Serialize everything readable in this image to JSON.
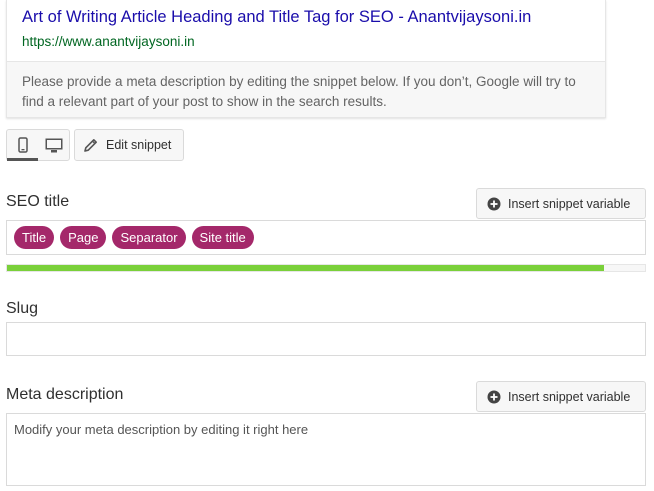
{
  "preview": {
    "title": "Art of Writing Article Heading and Title Tag for SEO - Anantvijaysoni.in",
    "url": "https://www.anantvijaysoni.in",
    "description": "Please provide a meta description by editing the snippet below. If you don’t, Google will try to find a relevant part of your post to show in the search results."
  },
  "toolbar": {
    "edit_snippet_label": "Edit snippet"
  },
  "seo_title": {
    "label": "SEO title",
    "insert_variable_label": "Insert snippet variable",
    "pills": [
      "Title",
      "Page",
      "Separator",
      "Site title"
    ],
    "progress_percent": 93.5
  },
  "slug": {
    "label": "Slug",
    "value": ""
  },
  "meta_description": {
    "label": "Meta description",
    "insert_variable_label": "Insert snippet variable",
    "value": "Modify your meta description by editing it right here"
  },
  "colors": {
    "pill": "#a4286a",
    "progress": "#7ad03a",
    "link_title": "#1a0dab",
    "link_url": "#006621"
  }
}
